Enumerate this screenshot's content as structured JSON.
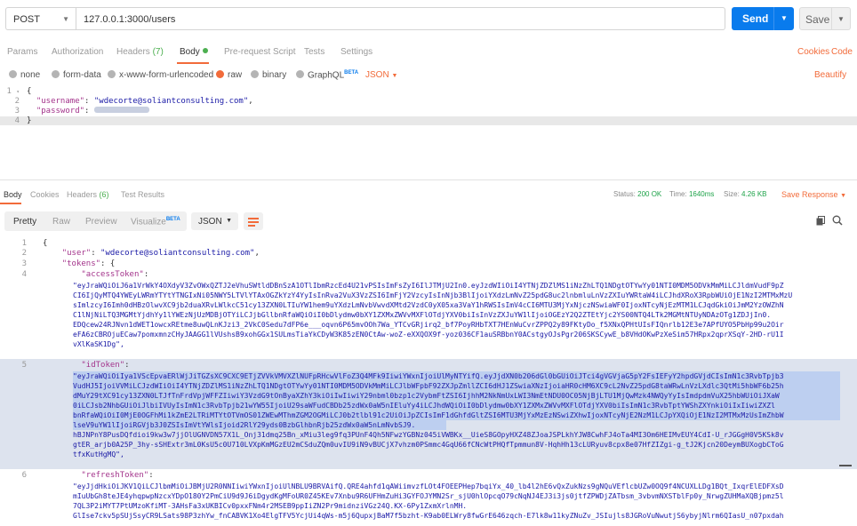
{
  "request": {
    "method": "POST",
    "url": "127.0.0.1:3000/users",
    "send_label": "Send",
    "save_label": "Save"
  },
  "request_tabs": {
    "params": "Params",
    "authorization": "Authorization",
    "headers": "Headers",
    "headers_count": "(7)",
    "body": "Body",
    "pre_request": "Pre-request Script",
    "tests": "Tests",
    "settings": "Settings",
    "cookies": "Cookies",
    "code": "Code"
  },
  "body_types": {
    "none": "none",
    "form_data": "form-data",
    "urlencoded": "x-www-form-urlencoded",
    "raw": "raw",
    "binary": "binary",
    "graphql": "GraphQL",
    "graphql_badge": "BETA",
    "format": "JSON",
    "beautify": "Beautify"
  },
  "request_body": {
    "line_numbers": [
      "1",
      "2",
      "3",
      "4"
    ],
    "open_brace": "{",
    "username_key": "\"username\"",
    "username_value": "\"wdecorte@soliantconsulting.com\"",
    "password_key": "\"password\"",
    "close_brace": "}"
  },
  "response_tabs": {
    "body": "Body",
    "cookies": "Cookies",
    "headers": "Headers",
    "headers_count": "(6)",
    "test_results": "Test Results",
    "status_label": "Status:",
    "status_value": "200 OK",
    "time_label": "Time:",
    "time_value": "1640ms",
    "size_label": "Size:",
    "size_value": "4.26 KB",
    "save_response": "Save Response"
  },
  "response_view": {
    "pretty": "Pretty",
    "raw": "Raw",
    "preview": "Preview",
    "visualize": "Visualize",
    "visualize_badge": "BETA",
    "format": "JSON"
  },
  "response_body": {
    "line_numbers": [
      "1",
      "2",
      "3",
      "4",
      "5",
      "6"
    ],
    "open_brace": "{",
    "user_key": "\"user\"",
    "user_value": "\"wdecorte@soliantconsulting.com\"",
    "tokens_key": "\"tokens\"",
    "access_key": "\"accessToken\"",
    "id_key": "\"idToken\"",
    "refresh_key": "\"refreshToken\"",
    "access_token_lines": [
      "\"eyJraWQiOiJ6a1VrWkY4OXdyV3ZvOWxQZTJ2eVhuSWtldDBnSzA1OTlIbmRzcEd4U21vPSIsImFsZyI6IlJTMjU2In0.eyJzdWIiOiI4YTNjZDZlMS1iNzZhLTQ1NDgtOTYwYy01NTI0MDM5ODVkMmMiLCJldmVudF9pZ",
      "CI6IjQyMTQ4YWEyLWRmYTYtYTNGIxNi05NWY5LTVlYTAxOGZkYzY4YyIsInRva2VuX3VzZSI6ImFjY2VzcyIsInNjb3BlIjoiYXdzLmNvZ25pdG8uc2lnbmluLnVzZXIuYWRtaW4iLCJhdXRoX3RpbWUiOjE1NzI2MTMxMzU",
      "sImlzcyI6Imh0dHBzOlwvXC9jb2duaXRvLWlkcC51cy13ZXN0LTIuYW1hem9uYXdzLmNvbVwvdXMtd2VzdC0yX05xa3VaY1hRWSIsImV4cCI6MTU3MjYxNjczNSwiaWF0IjoxNTcyNjEzMTM1LCJqdGkiOiJmM2YzOWZhN",
      "C1lNjNiLTQ3MGMtYjdhYy1lYWEzNjUzMDBjOTYiLCJjbGllbnRfaWQiOiI0bDlydmw0bXY1ZXMxZWVvMXFlOTdjYXV0biIsInVzZXJuYW1lIjoiOGEzY2Q2ZTEtYjc2YS00NTQ4LTk2MGMtNTUyNDAzOTg1ZDJjIn0.",
      "EDQcew24RJNvn1dWET1owcxREtme8uwQLnKJzi3_2VkC0Sedu7dFP6e___oqvn6P65mvOOh7Wa_YTCvGRjirq2_bf7PoyRHbTXT7HEnWuCvrZPPQ2y89FKtyDo_f5XNxQPHtUIsFIQnrlb12E3e7APfUYO5PbHp99u2Oir",
      "eFA6zCBROjuECaw7pomxmnzCHyJAAGG1lVUshsB9xohGGx1SULmsTiaYkCDyW3K85zEN0CtAw-woZ-eXXQOX9f-yoz036CF1auSRBbnY0ACstgyOJsPgr206SKSCywE_b8VHdOKwPzXeSim57HRpx2qprXSqY-2HD-rU1I",
      "vXlKaSK1Dg\","
    ],
    "id_token_lines": [
      "\"eyJraWQiOiIya1VScEpvaERlWjJiTGZsXC9CXC9ETjZVVkVMVXZlNUFpRHcwVlFoZ3Q4MFk9IiwiYWxnIjoiUlMyNTYifQ.eyJjdXN0b206dGl0bGUiOiJTci4gVGVjaG5pY2FsIEFyY2hpdGVjdCIsImN1c3RvbTpjb3",
      "VudHJ5IjoiVVMiLCJzdWIiOiI4YTNjZDZlMS1iNzZhLTQ1NDgtOTYwYy01NTI0MDM5ODVkMmMiLCJlbWFpbF92ZXJpZmllZCI6dHJ1ZSwiaXNzIjoiaHR0cHM6XC9cL2NvZ25pdG8taWRwLnVzLXdlc3QtMi5hbWF6b25h",
      "dMuY29tXC91cy13ZXN0LTJfTnFrdVpjWFFZIiwiY3VzdG9tOnByaXZhY3kiOiIwIiwiY29nbml0bzp1c2VybmFtZSI6IjhhM2NkNmUxLWI3NmEtNDU0OC05NjBjLTU1MjQwMzk4NWQyYyIsImdpdmVuX25hbWUiOiJXaW",
      "0iLCJsb2NhbGUiOiJlbiIVUyIsImN1c3RvbTpjb21wYW55IjoiU29saWFudCBDb25zdWx0aW5nIEluYy4iLCJhdWQiOiI0bDlydmw0bXY1ZXMxZWVvMXFlOTdjYXV0biIsImN1c3RvbTptYWShZXYnkiOiIxIiwiZXZl",
      "bnRfaWQiOiI0MjE0OGFhMi1kZmE2LTRiMTYtOTVmOS01ZWEwMThmZGM2OGMiLCJ0b2tlbl91c2UiOiJpZCIsImF1dGhfdGltZSI6MTU3MjYxMzEzNSwiZXhwIjoxNTcyNjE2NzM1LCJpYXQiOjE1NzI2MTMxMzUsImZhbW",
      "lseV9uYW1lIjoiRGVjb3J0ZSIsImVtYWlsIjoid2RlY29yds0BzbGlhbnRjb25zdWx0aW5nLmNvbSJ9.",
      "hBJNPnY8PusDQfdioi9kw3w7jjOlUGNVDN57X1L_Onj31dmq25Bn_xMiu3leg9fq3PUnF4Qh5NFwzYGBNz045iVWBKx__UieS8GOpyHXZ48ZJoaJSPLkhYJW8CwhFJ4oTa4MI3Om6HEIMvEUY4CdI-U_rJGGgH0V5KSk8v",
      "gtER_arjb0A25P_3hy-sSHExtr3mL0KsU5c0U710LVXpKmMGzEU2mCSduZQm0uvIU9iN9vBUCjX7vhzm0PSmmc4GqU66fCNcWtPHQfTpmmun8V-HqhHh13cLURyuv8cpx8e07HfZIZgi-g_tJ2Kjcn20DeymBUXogbCToG",
      "tfxKutHgMQ\","
    ],
    "refresh_token_lines": [
      "\"eyJjdHkiOiJKV1QiLCJlbmMiOiJBMjU2R0NNIiwiYWxnIjoiUlNBLU9BRVAifQ.QRE4ahfd1qAWiimvzfLOt4FOEEPHep7bqiYx_40_lb4l2hE6vQxZukNzs9gNQuVEflcbUZw0OQ9f4NCUXLLDg1BQt_IxqrElEDFXsD",
      "mIuUbGh8teJE4yhqpwpNzcxYDpO180Y2PmCiU9d9J6iDgydKgMFoUR0Z45KEv7Xnbu9R6UFHmZuHi3GYFOJYMN2Sr_sjU0hlOpcqO79cNqNJ4EJ3i3js0jtfZPWDjZATbsm_3vbvmNXSTblFp0y_NrwgZUHMaXQBjpmz5l",
      "7QL3P2iMYT7PtUMzoKfiMT-3AHsFa3xUKBICv0pxxFNm4r2MSEB9ppIiZN2Pr9midnziVGz24Q.KX-6Py1ZxmXrlnMH.",
      "GlIse7ckv5pSUjSsyCR9LSats98P3zhYw_fnCABVK1Xo4ElgTFV5YcjUi4qWs-m5j6QupxjBaM7f5bzht-K9ab0ELWry8fwGrE646zqch-E7lk8w11kyZNuZv_JSIujls8JGRoVuNwutjS6ybyjNlrm6QIasU_n07pxdah"
    ]
  }
}
